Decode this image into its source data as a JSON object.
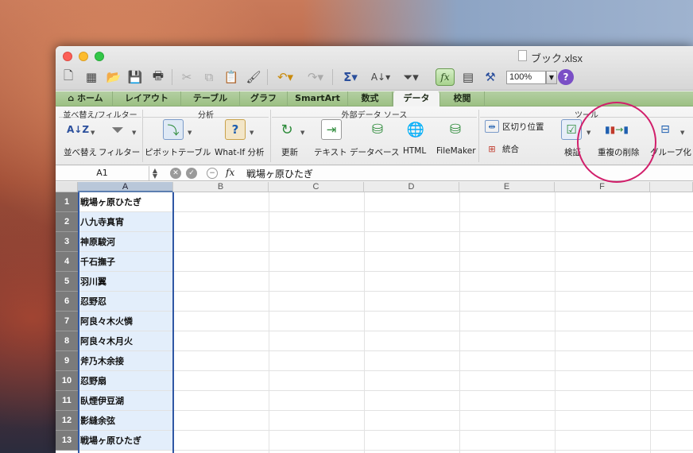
{
  "window": {
    "title": "ブック.xlsx"
  },
  "toolbar": {
    "zoom_value": "100%",
    "icons": [
      "new-icon",
      "gallery-icon",
      "open-icon",
      "save-icon",
      "print-icon",
      "cut-icon",
      "copy-icon",
      "paste-icon",
      "format-painter-icon",
      "undo-icon",
      "redo-icon",
      "autosum-icon",
      "sort-icon",
      "filter-icon",
      "formula-builder-icon",
      "show-formula-icon",
      "toolbox-icon",
      "help-icon"
    ]
  },
  "tabs": [
    {
      "label": "ホーム",
      "icon": "home-icon"
    },
    {
      "label": "レイアウト"
    },
    {
      "label": "テーブル"
    },
    {
      "label": "グラフ"
    },
    {
      "label": "SmartArt"
    },
    {
      "label": "数式"
    },
    {
      "label": "データ",
      "active": true
    },
    {
      "label": "校閲"
    }
  ],
  "ribbon": {
    "groups": {
      "sort_filter": "並べ替え/フィルター",
      "analysis": "分析",
      "external_data": "外部データ ソース",
      "tools": "ツール"
    },
    "buttons": {
      "sort": "並べ替え",
      "filter": "フィルター",
      "pivot_table": "ピボットテーブル",
      "what_if": "What-If 分析",
      "refresh": "更新",
      "text": "テキスト",
      "database": "データベース",
      "html": "HTML",
      "filemaker": "FileMaker",
      "text_to_columns": "区切り位置",
      "consolidate": "統合",
      "validate": "検証",
      "remove_duplicates": "重複の削除",
      "group": "グループ化"
    }
  },
  "formula_bar": {
    "cell_ref": "A1",
    "fx": "fx",
    "value": "戦場ヶ原ひたぎ"
  },
  "sheet": {
    "columns": [
      "A",
      "B",
      "C",
      "D",
      "E",
      "F"
    ],
    "selected_column": "A",
    "rows": [
      {
        "num": "1",
        "a": "戦場ヶ原ひたぎ"
      },
      {
        "num": "2",
        "a": "八九寺真宵"
      },
      {
        "num": "3",
        "a": "神原駿河"
      },
      {
        "num": "4",
        "a": "千石撫子"
      },
      {
        "num": "5",
        "a": "羽川翼"
      },
      {
        "num": "6",
        "a": "忍野忍"
      },
      {
        "num": "7",
        "a": "阿良々木火憐"
      },
      {
        "num": "8",
        "a": "阿良々木月火"
      },
      {
        "num": "9",
        "a": "斧乃木余接"
      },
      {
        "num": "10",
        "a": "忍野扇"
      },
      {
        "num": "11",
        "a": "臥煙伊豆湖"
      },
      {
        "num": "12",
        "a": "影縫余弦"
      },
      {
        "num": "13",
        "a": "戦場ヶ原ひたぎ"
      }
    ]
  },
  "colors": {
    "ribbon_tab_bar": "#9cc083",
    "selection": "#2f57a4",
    "annotation_circle": "#d11f6b"
  }
}
